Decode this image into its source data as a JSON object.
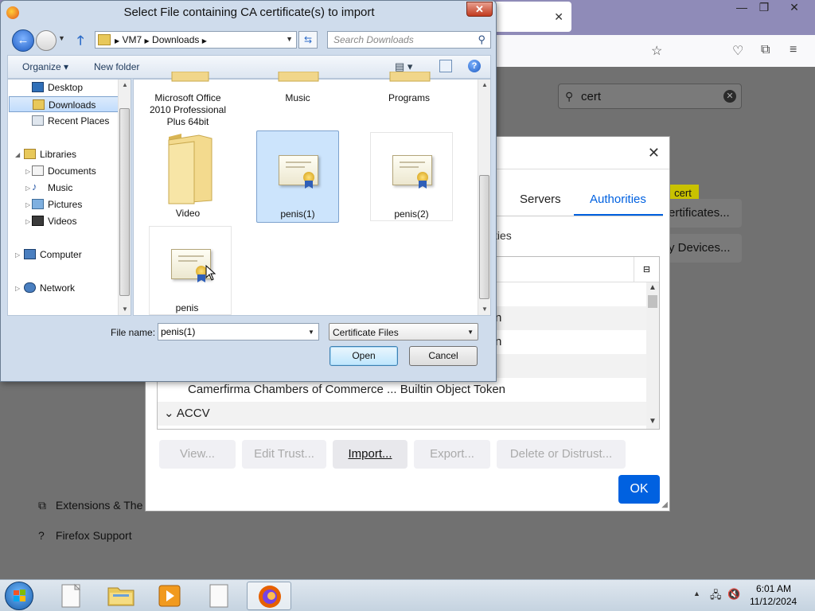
{
  "firefox": {
    "tab_close": "✕",
    "window_controls": [
      "—",
      "❐",
      "✕"
    ],
    "search_value": "cert",
    "sidebar": [
      {
        "label": "Extensions & The",
        "icon": "puzzle-icon"
      },
      {
        "label": "Firefox Support",
        "icon": "help-icon"
      }
    ],
    "highlight_text": "cert",
    "side_buttons": [
      "ertificates...",
      "y Devices..."
    ]
  },
  "cert_manager": {
    "close": "✕",
    "tabs": [
      "Servers",
      "Authorities"
    ],
    "active_tab": "Authorities",
    "description_fragment": "ties",
    "rows": [
      {
        "text": "",
        "alt": false
      },
      {
        "text": "n",
        "alt": true
      },
      {
        "text": "n",
        "alt": false
      },
      {
        "text": "",
        "alt": true
      },
      {
        "text": "Camerfirma Chambers of Commerce ... Builtin Object Token",
        "alt": false
      },
      {
        "text": "⌄ ACCV",
        "alt": true
      }
    ],
    "buttons": {
      "view": "View...",
      "edit_trust": "Edit Trust...",
      "import": "Import...",
      "export": "Export...",
      "delete": "Delete or Distrust..."
    },
    "ok": "OK"
  },
  "open_dialog": {
    "title": "Select File containing CA certificate(s) to import",
    "close": "✕",
    "address": [
      "VM7",
      "Downloads"
    ],
    "search_placeholder": "Search Downloads",
    "toolbar": {
      "organize": "Organize ▾",
      "new_folder": "New folder"
    },
    "nav": [
      {
        "label": "Desktop",
        "icon": "desktop-icon"
      },
      {
        "label": "Downloads",
        "icon": "downloads-folder-icon",
        "selected": true
      },
      {
        "label": "Recent Places",
        "icon": "recent-places-icon"
      },
      {
        "label": "Libraries",
        "icon": "libraries-icon"
      },
      {
        "label": "Documents",
        "icon": "documents-icon"
      },
      {
        "label": "Music",
        "icon": "music-icon"
      },
      {
        "label": "Pictures",
        "icon": "pictures-icon"
      },
      {
        "label": "Videos",
        "icon": "videos-icon"
      },
      {
        "label": "Computer",
        "icon": "computer-icon"
      },
      {
        "label": "Network",
        "icon": "network-icon"
      }
    ],
    "files": [
      {
        "name": "Microsoft Office 2010 Professional Plus 64bit",
        "type": "folder"
      },
      {
        "name": "Music",
        "type": "folder"
      },
      {
        "name": "Programs",
        "type": "folder"
      },
      {
        "name": "Video",
        "type": "folder"
      },
      {
        "name": "penis(1)",
        "type": "certificate",
        "selected": true
      },
      {
        "name": "penis(2)",
        "type": "certificate"
      },
      {
        "name": "penis",
        "type": "certificate"
      }
    ],
    "file_name_label": "File name:",
    "file_name_value": "penis(1)",
    "filter": "Certificate Files",
    "open": "Open",
    "cancel": "Cancel"
  },
  "taskbar": {
    "time": "6:01 AM",
    "date": "11/12/2024"
  }
}
